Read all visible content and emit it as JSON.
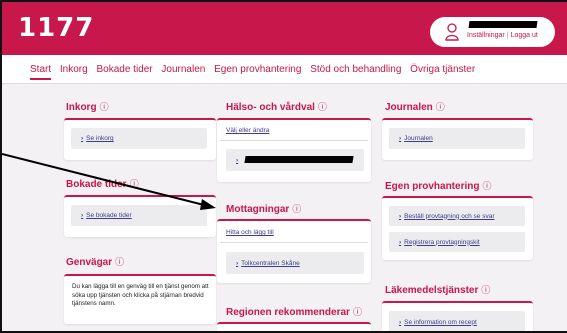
{
  "header": {
    "logo": "1177",
    "user_links": {
      "settings": "Inställningar",
      "logout": "Logga ut"
    }
  },
  "nav": {
    "items": [
      "Start",
      "Inkorg",
      "Bokade tider",
      "Journalen",
      "Egen provhantering",
      "Stöd och behandling",
      "Övriga tjänster"
    ]
  },
  "sections": {
    "inkorg": {
      "title": "Inkorg",
      "info": "ⓘ",
      "link": "Se inkorg"
    },
    "halso": {
      "title": "Hälso- och vårdval",
      "info": "ⓘ",
      "link": "Välj eller ändra"
    },
    "journalen": {
      "title": "Journalen",
      "info": "ⓘ",
      "link": "Journalen"
    },
    "bokade": {
      "title": "Bokade tider",
      "info": "ⓘ",
      "link": "Se bokade tider"
    },
    "mottagningar": {
      "title": "Mottagningar",
      "info": "ⓘ",
      "find": "Hitta och lägg till",
      "link": "Tolkcentralen Skåne"
    },
    "egen": {
      "title": "Egen provhantering",
      "info": "ⓘ",
      "link1": "Beställ provtagning och se svar",
      "link2": "Registrera provtagningskit"
    },
    "genvagar": {
      "title": "Genvägar",
      "info": "ⓘ",
      "text": "Du kan lägga till en genväg till en tjänst genom att söka upp tjänsten och klicka på stjärnan bredvid tjänstens namn."
    },
    "lakemedel": {
      "title": "Läkemedelstjänster",
      "info": "ⓘ",
      "link": "Se information om recept"
    },
    "regionen": {
      "title": "Regionen rekommenderar",
      "info": "ⓘ"
    }
  },
  "colors": {
    "brand": "#c8174a",
    "link": "#3a3c8c",
    "background": "#f3f1f3"
  },
  "icons": {
    "user": "user-icon",
    "chevron": "chevron-right-icon",
    "info": "info-icon"
  }
}
